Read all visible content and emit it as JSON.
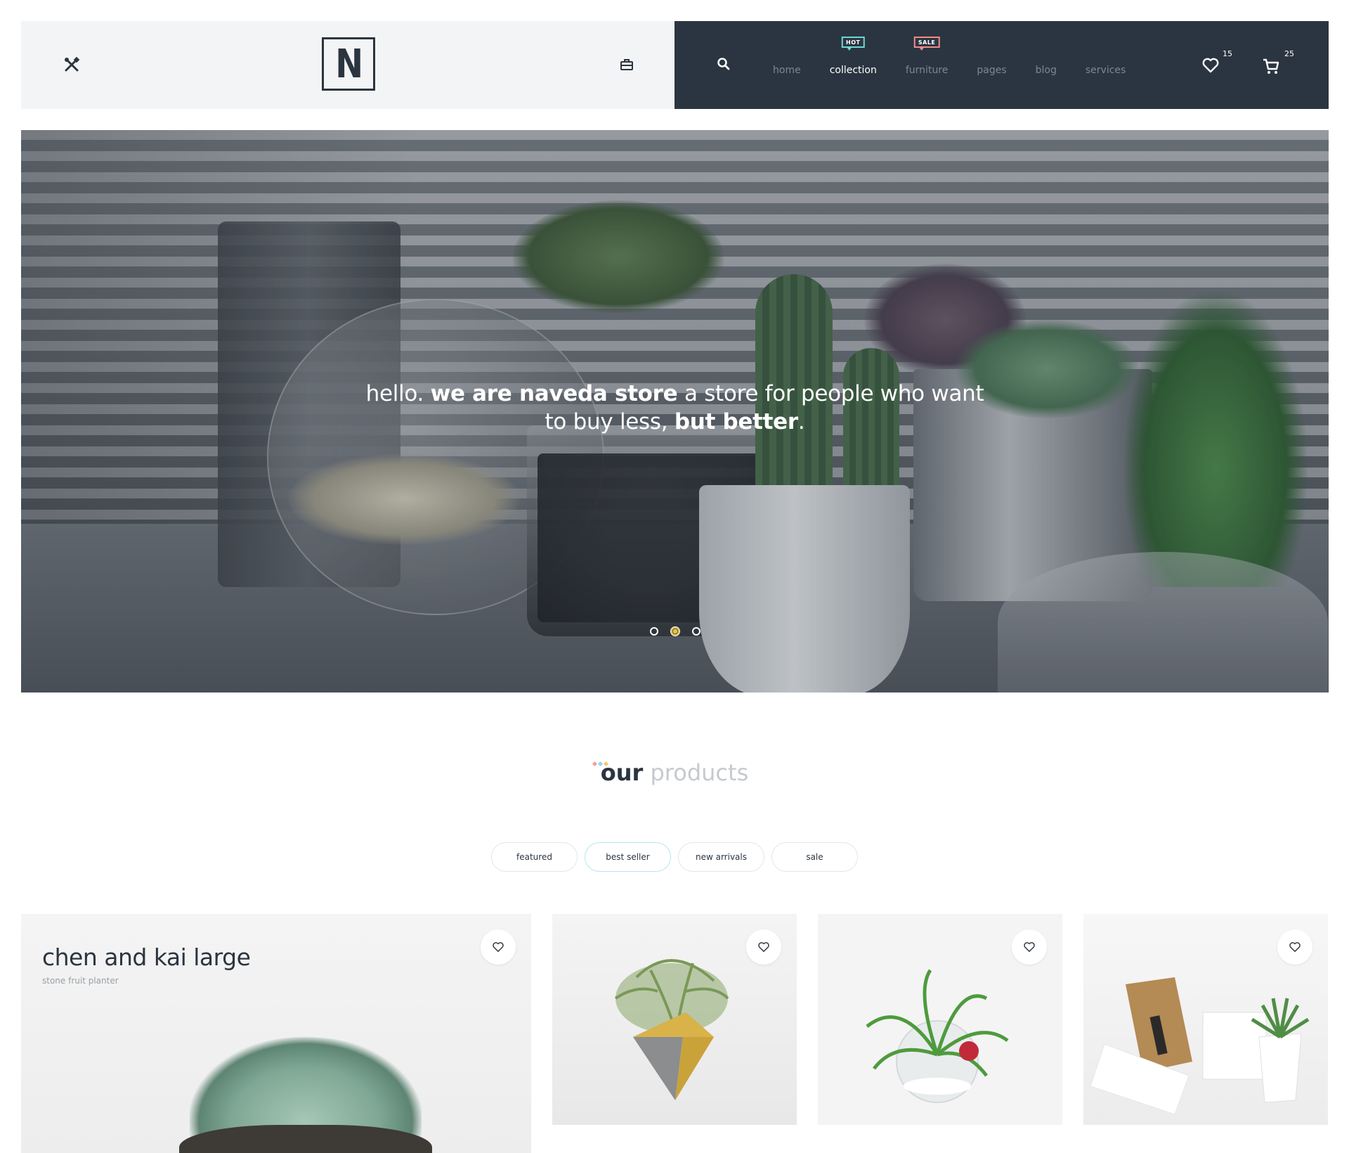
{
  "header": {
    "logo_letter": "N",
    "nav": [
      {
        "label": "home",
        "badge": ""
      },
      {
        "label": "collection",
        "badge": "HOT",
        "active": true
      },
      {
        "label": "furniture",
        "badge": "SALE"
      },
      {
        "label": "pages",
        "badge": ""
      },
      {
        "label": "blog",
        "badge": ""
      },
      {
        "label": "services",
        "badge": ""
      }
    ],
    "wishlist_count": "15",
    "cart_count": "25",
    "icons": [
      "tools-icon",
      "briefcase-icon",
      "search-icon",
      "heart-icon",
      "cart-icon"
    ],
    "colors": {
      "left_bg": "#f3f4f5",
      "right_bg": "#2b3541",
      "hot": "#6ed7d3",
      "sale": "#f28a8a"
    }
  },
  "hero": {
    "text_normal_1": "hello. ",
    "text_bold_1": "we are naveda store",
    "text_normal_2": " a store for people who want",
    "text_normal_3": "to buy less, ",
    "text_bold_2": "but better",
    "text_end": ".",
    "slides": 3,
    "active_slide": 2
  },
  "products": {
    "title_bold": "our",
    "title_light": "products",
    "filters": [
      {
        "label": "featured",
        "active": false
      },
      {
        "label": "best seller",
        "active": true
      },
      {
        "label": "new arrivals",
        "active": false
      },
      {
        "label": "sale",
        "active": false
      }
    ],
    "featured_card": {
      "title": "chen and kai large",
      "subtitle": "stone fruit planter"
    }
  }
}
